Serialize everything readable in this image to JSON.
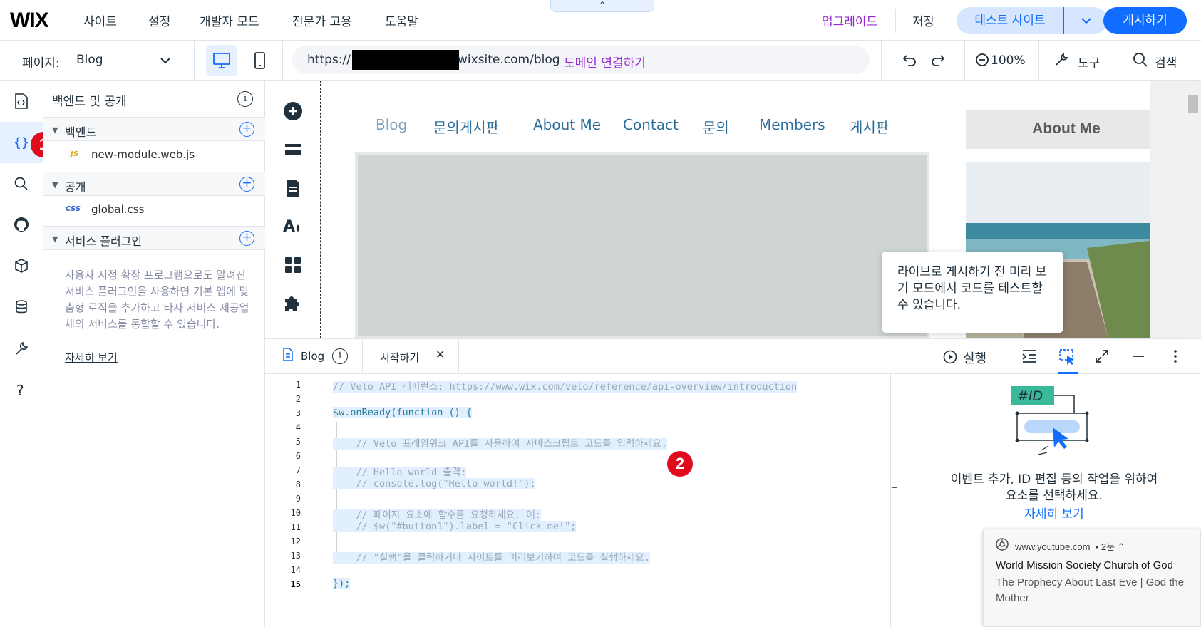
{
  "topbar": {
    "logo": "WIX",
    "menu": [
      "사이트",
      "설정",
      "개발자 모드",
      "전문가 고용",
      "도움말"
    ],
    "upgrade": "업그레이드",
    "save": "저장",
    "test_site": "테스트 사이트",
    "publish": "게시하기",
    "collapse_glyph": "⌃"
  },
  "secondbar": {
    "page_label": "페이지:",
    "page_name": "Blog",
    "url_prefix": "https://",
    "url_suffix": "wixsite.com/blog",
    "connect_domain": "도메인 연결하기",
    "zoom": "100%",
    "tools": "도구",
    "search": "검색"
  },
  "rail": {
    "icons": [
      "pages-code-icon",
      "braces-icon",
      "search-icon",
      "github-icon",
      "package-icon",
      "database-icon",
      "wrench-icon",
      "help-icon"
    ],
    "active": "braces-icon",
    "badge": "1"
  },
  "panel": {
    "title": "백엔드 및 공개",
    "sections": [
      {
        "title": "백엔드",
        "files": [
          {
            "tag": "JS",
            "name": "new-module.web.js"
          }
        ]
      },
      {
        "title": "공개",
        "files": [
          {
            "tag": "CSS",
            "name": "global.css"
          }
        ]
      },
      {
        "title": "서비스 플러그인",
        "files": []
      }
    ],
    "plugin_desc": "사용자 지정 확장 프로그램으로도 알려진 서비스 플러그인을 사용하면 기본 앱에 맞춤형 로직을 추가하고 타사 서비스 제공업체의 서비스를 통합할 수 있습니다.",
    "learn_more": "자세히 보기"
  },
  "canvas": {
    "nav": [
      "Blog",
      "문의게시판",
      "About Me",
      "Contact",
      "문의",
      "Members",
      "게시판"
    ],
    "current_nav": "Blog",
    "about_title": "About Me",
    "tooltip": "라이브로 게시하기 전 미리 보기 모드에서 코드를 테스트할 수 있습니다."
  },
  "codebar": {
    "tab_blog": "Blog",
    "tab_start": "시작하기",
    "run": "실행"
  },
  "editor": {
    "lines": [
      "// Velo API 레퍼런스: https://www.wix.com/velo/reference/api-overview/introduction",
      "",
      "$w.onReady(function () {",
      "",
      "    // Velo 프레임워크 API를 사용하여 자바스크립트 코드를 입력하세요.",
      "",
      "    // Hello world 출력:",
      "    // console.log(\"Hello world!\");",
      "",
      "    // 페이지 요소에 함수를 요청하세요. 예:",
      "    // $w(\"#button1\").label = \"Click me!\";",
      "",
      "    // \"실행\"을 클릭하거나 사이트를 미리보기하여 코드를 실행하세요.",
      "",
      "});"
    ],
    "current_line": 15,
    "badge": "2"
  },
  "inspector": {
    "id_tag": "#ID",
    "text": "이벤트 추가, ID 편집 등의 작업을 위하여 요소를 선택하세요.",
    "link": "자세히 보기"
  },
  "notification": {
    "source": "www.youtube.com",
    "time": "• 2분",
    "title": "World Mission Society Church of God",
    "body": "The Prophecy About Last Eve | God the Mother"
  },
  "colors": {
    "accent": "#116dff",
    "upgrade": "#9a27d5",
    "badge": "#e00b1d"
  }
}
